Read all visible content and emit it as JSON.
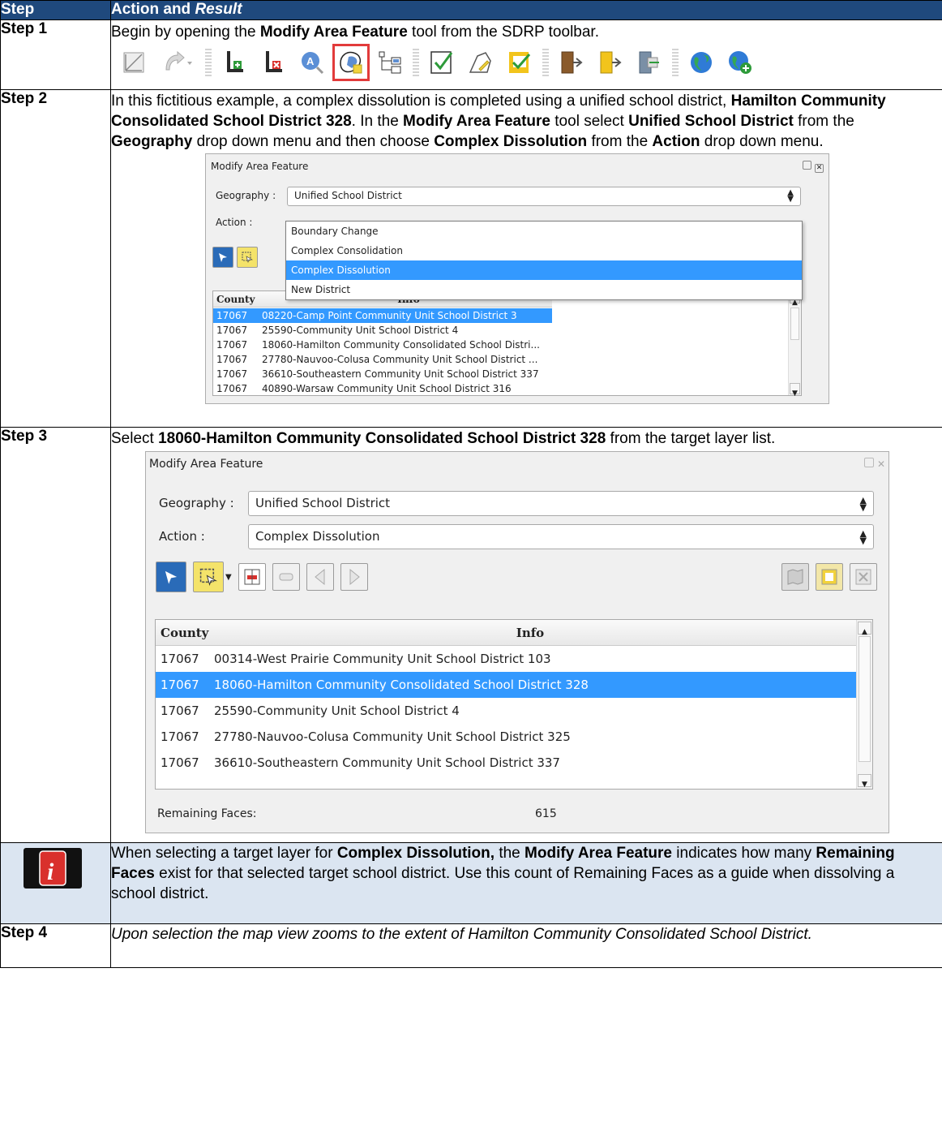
{
  "header": {
    "step": "Step",
    "action_plain": "Action and ",
    "action_italic": "Result"
  },
  "step1": {
    "label": "Step 1",
    "t1": "Begin by opening the ",
    "b1": "Modify Area Feature",
    "t2": " tool from the SDRP toolbar.",
    "toolbar_icons": [
      "measure-icon",
      "identify-arrow-icon",
      "dropdown-arrow-icon",
      "add-node-icon",
      "delete-node-icon",
      "search-feature-icon",
      "modify-area-feature-icon",
      "topology-icon",
      "validate-icon",
      "polygon-icon",
      "review-icon",
      "export-left-icon",
      "export-right-icon",
      "export-gray-icon",
      "globe-icon",
      "add-globe-icon"
    ]
  },
  "step2": {
    "label": "Step 2",
    "t1": "In this fictitious example, a complex dissolution is completed using a unified school district, ",
    "b1": "Hamilton Community Consolidated School District 328",
    "t2": ". In the ",
    "b2": "Modify Area Feature",
    "t3": " tool select ",
    "b3": "Unified School District",
    "t4": " from the ",
    "b4": "Geography",
    "t5": " drop down menu and then choose ",
    "b5": "Complex Dissolution",
    "t6": " from the ",
    "b6": "Action",
    "t7": " drop down menu.",
    "dialog": {
      "title": "Modify Area Feature",
      "geography_label": "Geography :",
      "geography_value": "Unified School District",
      "action_label": "Action :",
      "options": [
        "Boundary Change",
        "Complex Consolidation",
        "Complex Dissolution",
        "New District"
      ],
      "col_county": "County",
      "col_info": "Info",
      "rows": [
        {
          "county": "17067",
          "info": "08220-Camp Point Community Unit School District 3"
        },
        {
          "county": "17067",
          "info": "25590-Community Unit School District 4"
        },
        {
          "county": "17067",
          "info": "18060-Hamilton Community Consolidated School Distri..."
        },
        {
          "county": "17067",
          "info": "27780-Nauvoo-Colusa Community Unit School District ..."
        },
        {
          "county": "17067",
          "info": "36610-Southeastern Community Unit School District 337"
        },
        {
          "county": "17067",
          "info": "40890-Warsaw Community Unit School District 316"
        }
      ]
    }
  },
  "step3": {
    "label": "Step 3",
    "t1": "Select ",
    "b1": "18060-Hamilton Community Consolidated School District 328",
    "t2": " from the target layer list.",
    "dialog": {
      "title": "Modify Area Feature",
      "geography_label": "Geography :",
      "geography_value": "Unified School District",
      "action_label": "Action :",
      "action_value": "Complex Dissolution",
      "col_county": "County",
      "col_info": "Info",
      "rows": [
        {
          "county": "17067",
          "info": "00314-West Prairie Community Unit School District 103"
        },
        {
          "county": "17067",
          "info": "18060-Hamilton Community Consolidated School District 328"
        },
        {
          "county": "17067",
          "info": "25590-Community Unit School District 4"
        },
        {
          "county": "17067",
          "info": "27780-Nauvoo-Colusa Community Unit School District 325"
        },
        {
          "county": "17067",
          "info": "36610-Southeastern Community Unit School District 337"
        }
      ],
      "remaining_label": "Remaining Faces:",
      "remaining_value": "615"
    }
  },
  "note": {
    "t1": "When selecting a target layer for ",
    "b1": "Complex Dissolution,",
    "t2": " the ",
    "b2": "Modify Area Feature",
    "t3": " indicates how many ",
    "b3": "Remaining Faces",
    "t4": " exist for that selected target school district. Use this count of Remaining Faces as a guide when dissolving a school district."
  },
  "step4": {
    "label": "Step 4",
    "text": "Upon selection the map view zooms to the extent of Hamilton Community Consolidated School District."
  }
}
